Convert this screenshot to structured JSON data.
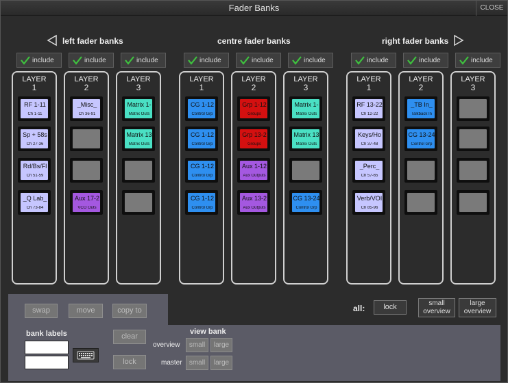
{
  "window": {
    "title": "Fader Banks",
    "close_label": "CLOSE"
  },
  "sections": [
    {
      "title": "left fader banks"
    },
    {
      "title": "centre fader banks"
    },
    {
      "title": "right fader banks"
    }
  ],
  "include_label": "include",
  "layer_label": "LAYER",
  "columns": [
    {
      "layer": "1",
      "banks": [
        {
          "name": "RF 1-11",
          "sub": "Ch 1-11",
          "color": "#c6c6ff"
        },
        {
          "name": "Sp + 58s",
          "sub": "Ch 27-36",
          "color": "#c6c6ff"
        },
        {
          "name": "Rd/Bs/Fl",
          "sub": "Ch 51-59",
          "color": "#c6c6ff"
        },
        {
          "name": "_Q Lab_",
          "sub": "Ch 73-84",
          "color": "#c6c6ff"
        }
      ]
    },
    {
      "layer": "2",
      "banks": [
        {
          "name": "_Misc_",
          "sub": "Ch 36-91",
          "color": "#c6c6ff"
        },
        {
          "name": "",
          "sub": "",
          "color": ""
        },
        {
          "name": "",
          "sub": "",
          "color": ""
        },
        {
          "name": "Aux 17-2",
          "sub": "VCO Outs",
          "color": "#a458e0"
        }
      ]
    },
    {
      "layer": "3",
      "banks": [
        {
          "name": "Matrix 1-",
          "sub": "Matrix Outs",
          "color": "#4ae0c4"
        },
        {
          "name": "Matrix 13",
          "sub": "Matrix Outs",
          "color": "#4ae0c4"
        },
        {
          "name": "",
          "sub": "",
          "color": ""
        },
        {
          "name": "",
          "sub": "",
          "color": ""
        }
      ]
    },
    {
      "layer": "1",
      "banks": [
        {
          "name": "CG 1-12",
          "sub": "Control Grp",
          "color": "#2e8ff0"
        },
        {
          "name": "CG 1-12",
          "sub": "Control Grp",
          "color": "#2e8ff0"
        },
        {
          "name": "CG 1-12",
          "sub": "Control Grp",
          "color": "#2e8ff0"
        },
        {
          "name": "CG 1-12",
          "sub": "Control Grp",
          "color": "#2e8ff0"
        }
      ]
    },
    {
      "layer": "2",
      "banks": [
        {
          "name": "Grp 1-12",
          "sub": "Groups",
          "color": "#d41010"
        },
        {
          "name": "Grp 13-2",
          "sub": "Groups",
          "color": "#d41010"
        },
        {
          "name": "Aux 1-12",
          "sub": "Aux Outputs",
          "color": "#a458e0"
        },
        {
          "name": "Aux 13-2",
          "sub": "Aux Outputs",
          "color": "#a458e0"
        }
      ]
    },
    {
      "layer": "3",
      "banks": [
        {
          "name": "Matrix 1-",
          "sub": "Matrix Outs",
          "color": "#4ae0c4"
        },
        {
          "name": "Matrix 13",
          "sub": "Matrix Outs",
          "color": "#4ae0c4"
        },
        {
          "name": "",
          "sub": "",
          "color": ""
        },
        {
          "name": "CG 13-24",
          "sub": "Control Grp",
          "color": "#2e8ff0"
        }
      ]
    },
    {
      "layer": "1",
      "banks": [
        {
          "name": "RF 13-22",
          "sub": "Ch 12-22",
          "color": "#c6c6ff"
        },
        {
          "name": "Keys/Ho",
          "sub": "Ch 37-48",
          "color": "#c6c6ff"
        },
        {
          "name": "_Perc_",
          "sub": "Ch 57-65",
          "color": "#c6c6ff"
        },
        {
          "name": "Verb/VOI",
          "sub": "Ch 85-96",
          "color": "#c6c6ff"
        }
      ]
    },
    {
      "layer": "2",
      "banks": [
        {
          "name": "_TB In_",
          "sub": "Talkback In",
          "color": "#2e8ff0"
        },
        {
          "name": "CG 13-24",
          "sub": "Control Grp",
          "color": "#2e8ff0"
        },
        {
          "name": "",
          "sub": "",
          "color": ""
        },
        {
          "name": "",
          "sub": "",
          "color": ""
        }
      ]
    },
    {
      "layer": "3",
      "banks": [
        {
          "name": "",
          "sub": "",
          "color": ""
        },
        {
          "name": "",
          "sub": "",
          "color": ""
        },
        {
          "name": "",
          "sub": "",
          "color": ""
        },
        {
          "name": "",
          "sub": "",
          "color": ""
        }
      ]
    }
  ],
  "all": {
    "label": "all:",
    "lock": "lock",
    "small_overview": "small overview",
    "large_overview": "large overview"
  },
  "toolbar": {
    "swap": "swap",
    "move": "move",
    "copy_to": "copy to",
    "clear": "clear",
    "lock": "lock"
  },
  "bank_labels": {
    "title": "bank labels",
    "field1": "",
    "field2": ""
  },
  "view_bank": {
    "title": "view bank",
    "overview_label": "overview",
    "master_label": "master",
    "small": "small",
    "large": "large"
  },
  "colors": {
    "check": "#3ec23e",
    "bottom_panel": "#5b5b66"
  }
}
